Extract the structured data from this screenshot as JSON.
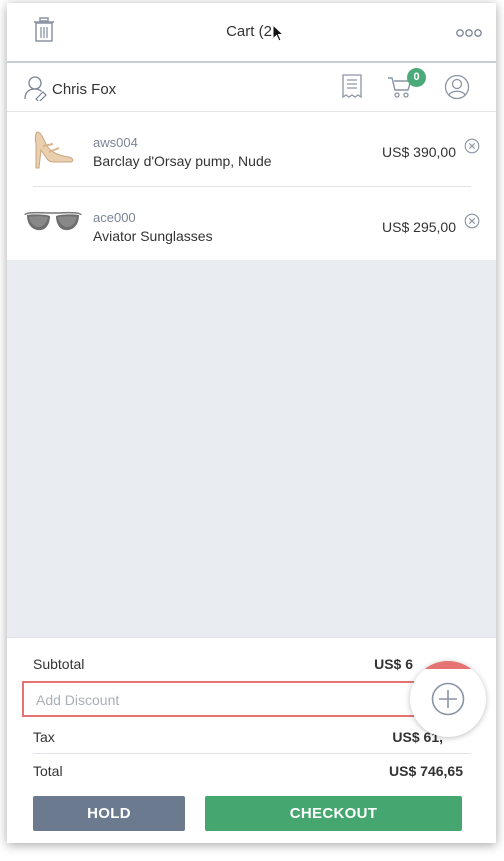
{
  "header": {
    "title": "Cart (2)"
  },
  "customer": {
    "name": "Chris Fox",
    "cart_badge": "0"
  },
  "items": [
    {
      "sku": "aws004",
      "name": "Barclay d'Orsay pump, Nude",
      "price": "US$ 390,00",
      "thumb": "heel-shoe"
    },
    {
      "sku": "ace000",
      "name": "Aviator Sunglasses",
      "price": "US$ 295,00",
      "thumb": "sunglasses"
    }
  ],
  "summary": {
    "subtotal_label": "Subtotal",
    "subtotal_value": "US$ 6",
    "discount_placeholder": "Add Discount",
    "tax_label": "Tax",
    "tax_value": "US$ 61,",
    "total_label": "Total",
    "total_value": "US$ 746,65"
  },
  "actions": {
    "hold_label": "HOLD",
    "checkout_label": "CHECKOUT"
  },
  "colors": {
    "accent_green": "#46a66f",
    "hold_gray": "#6b7a8f",
    "badge_green": "#4caa7a",
    "discount_border": "#e57373"
  }
}
